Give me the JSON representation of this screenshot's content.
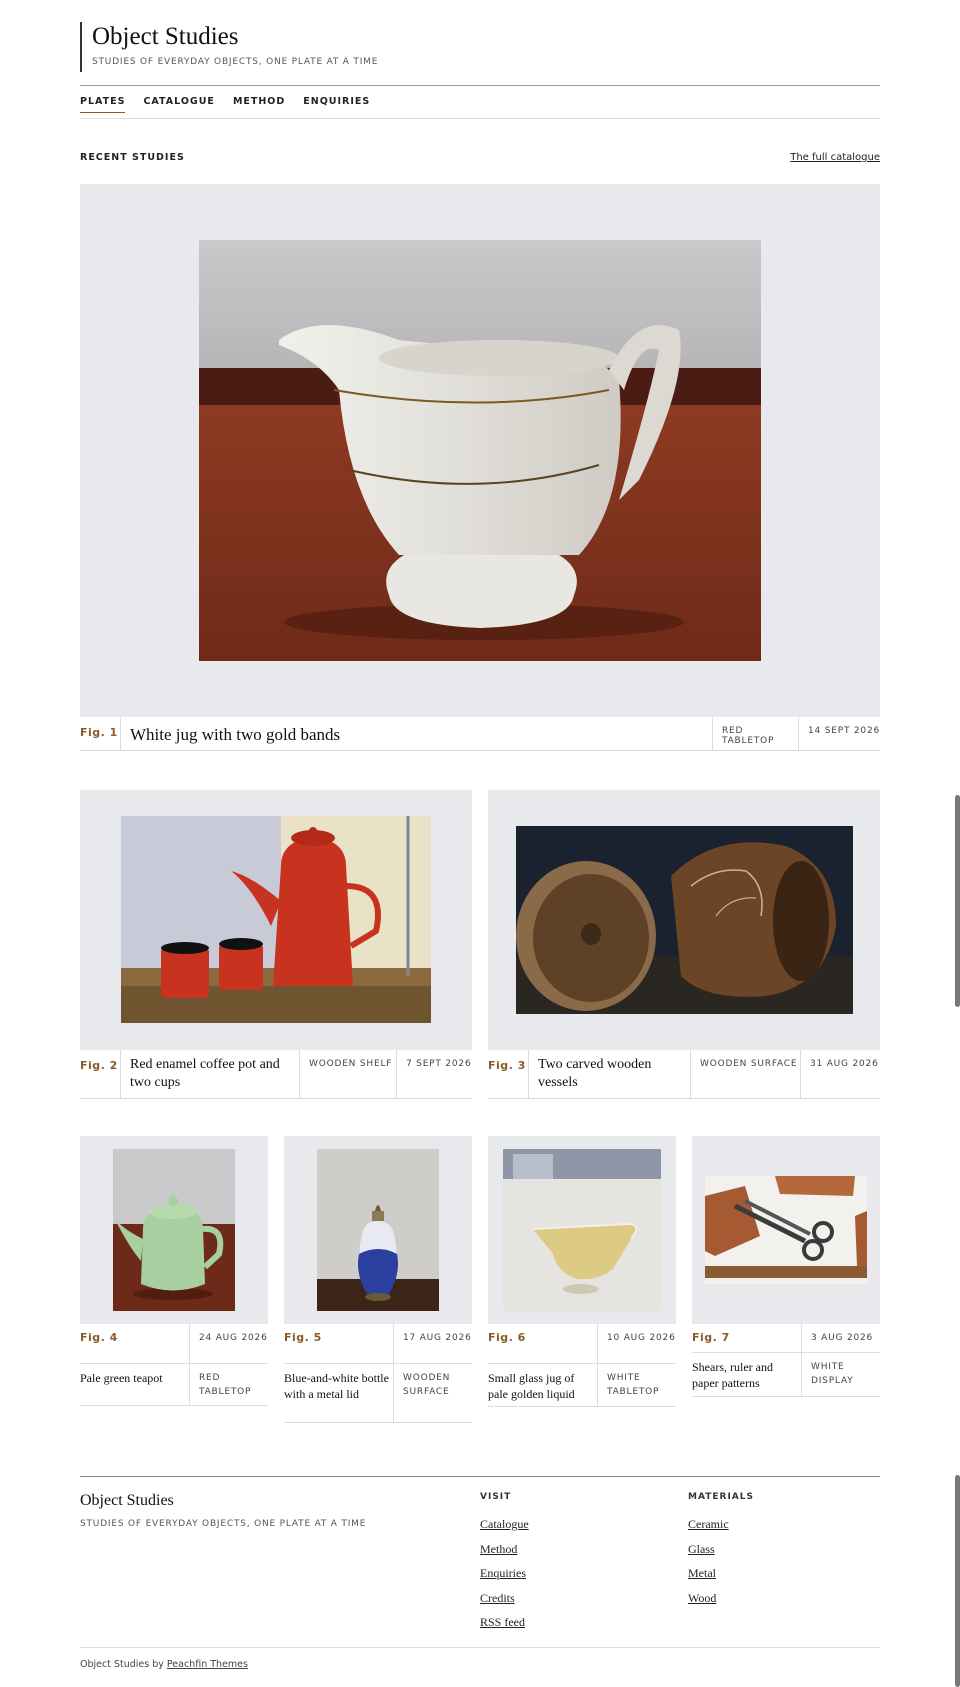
{
  "site": {
    "title": "Object Studies",
    "tagline": "STUDIES OF EVERYDAY OBJECTS, ONE PLATE AT A TIME"
  },
  "nav": {
    "items": [
      {
        "label": "PLATES",
        "active": true
      },
      {
        "label": "CATALOGUE"
      },
      {
        "label": "METHOD"
      },
      {
        "label": "ENQUIRIES"
      }
    ]
  },
  "section": {
    "label": "RECENT STUDIES",
    "link": "The full catalogue"
  },
  "plates": [
    {
      "fig": "Fig. 1",
      "title": "White jug with two gold bands",
      "surface": "RED TABLETOP",
      "date": "14 SEPT 2026"
    },
    {
      "fig": "Fig. 2",
      "title": "Red enamel coffee pot and two cups",
      "surface": "WOODEN SHELF",
      "date": "7 SEPT 2026"
    },
    {
      "fig": "Fig. 3",
      "title": "Two carved wooden vessels",
      "surface": "WOODEN SURFACE",
      "date": "31 AUG 2026"
    },
    {
      "fig": "Fig. 4",
      "title": "Pale green teapot",
      "surface": "RED TABLETOP",
      "date": "24 AUG 2026"
    },
    {
      "fig": "Fig. 5",
      "title": "Blue-and-white bottle with a metal lid",
      "surface": "WOODEN SURFACE",
      "date": "17 AUG 2026"
    },
    {
      "fig": "Fig. 6",
      "title": "Small glass jug of pale golden liquid",
      "surface": "WHITE TABLETOP",
      "date": "10 AUG 2026"
    },
    {
      "fig": "Fig. 7",
      "title": "Shears, ruler and paper patterns",
      "surface": "WHITE DISPLAY",
      "date": "3 AUG 2026"
    }
  ],
  "footer": {
    "title": "Object Studies",
    "tagline": "STUDIES OF EVERYDAY OBJECTS, ONE PLATE AT A TIME",
    "visit": {
      "heading": "VISIT",
      "links": [
        "Catalogue",
        "Method",
        "Enquiries",
        "Credits",
        "RSS feed"
      ]
    },
    "materials": {
      "heading": "MATERIALS",
      "links": [
        "Ceramic",
        "Glass",
        "Metal",
        "Wood"
      ]
    },
    "credit_prefix": "Object Studies by",
    "credit_link": "Peachfin Themes"
  },
  "colors": {
    "accent": "#8a5a2a",
    "plate_background": "#e8e9ec"
  }
}
